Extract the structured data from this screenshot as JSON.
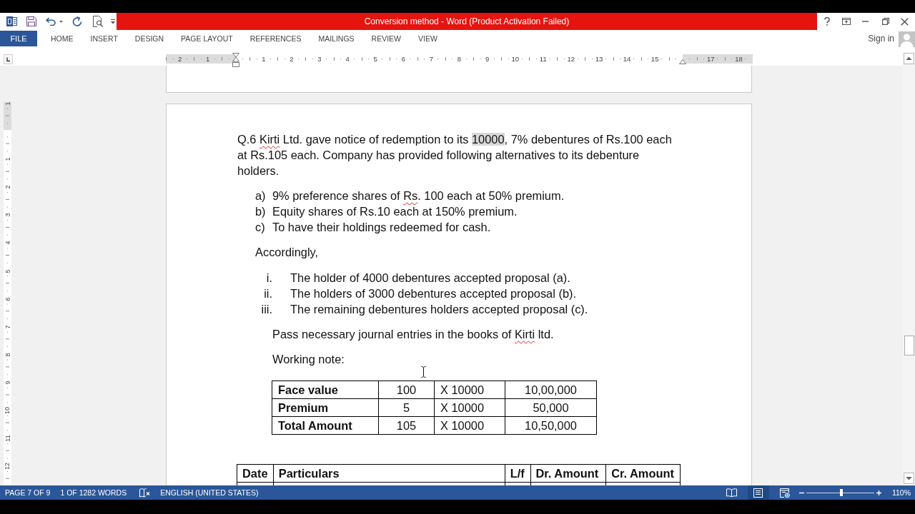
{
  "title_bar": {
    "title": "Conversion method - Word (Product Activation Failed)"
  },
  "ribbon_tabs": [
    {
      "label": "FILE",
      "kind": "file",
      "selected": false
    },
    {
      "label": "HOME",
      "kind": "tab",
      "selected": false
    },
    {
      "label": "INSERT",
      "kind": "tab",
      "selected": false
    },
    {
      "label": "DESIGN",
      "kind": "tab",
      "selected": false
    },
    {
      "label": "PAGE LAYOUT",
      "kind": "tab",
      "selected": false
    },
    {
      "label": "REFERENCES",
      "kind": "tab",
      "selected": false
    },
    {
      "label": "MAILINGS",
      "kind": "tab",
      "selected": false
    },
    {
      "label": "REVIEW",
      "kind": "tab",
      "selected": false
    },
    {
      "label": "VIEW",
      "kind": "tab",
      "selected": false
    }
  ],
  "account": {
    "label": "Sign in"
  },
  "horizontal_ruler": [
    {
      "kind": "label",
      "label": "2"
    },
    {
      "kind": "label",
      "label": "1"
    },
    {
      "kind": "left-indent"
    },
    {
      "kind": "label",
      "label": "1"
    },
    {
      "kind": "label",
      "label": "2"
    },
    {
      "kind": "label",
      "label": "3"
    },
    {
      "kind": "label",
      "label": "4"
    },
    {
      "kind": "label",
      "label": "5"
    },
    {
      "kind": "label",
      "label": "6"
    },
    {
      "kind": "label",
      "label": "7"
    },
    {
      "kind": "label",
      "label": "8"
    },
    {
      "kind": "label",
      "label": "9"
    },
    {
      "kind": "label",
      "label": "10"
    },
    {
      "kind": "label",
      "label": "11"
    },
    {
      "kind": "label",
      "label": "12"
    },
    {
      "kind": "label",
      "label": "13"
    },
    {
      "kind": "label",
      "label": "14"
    },
    {
      "kind": "label",
      "label": "15"
    },
    {
      "kind": "right-indent"
    },
    {
      "kind": "label",
      "label": "17"
    },
    {
      "kind": "label",
      "label": "18"
    }
  ],
  "vertical_ruler": [
    {
      "kind": "label",
      "label": "1"
    },
    {
      "kind": "margin"
    },
    {
      "kind": "label",
      "label": "1"
    },
    {
      "kind": "label",
      "label": "2"
    },
    {
      "kind": "label",
      "label": "3"
    },
    {
      "kind": "label",
      "label": "4"
    },
    {
      "kind": "label",
      "label": "5"
    },
    {
      "kind": "label",
      "label": "6"
    },
    {
      "kind": "label",
      "label": "7"
    },
    {
      "kind": "label",
      "label": "8"
    },
    {
      "kind": "label",
      "label": "9"
    },
    {
      "kind": "label",
      "label": "10"
    },
    {
      "kind": "label",
      "label": "11"
    },
    {
      "kind": "label",
      "label": "12"
    }
  ],
  "document": {
    "question": {
      "runs": [
        {
          "text": "Q.6 ",
          "kind": "plain"
        },
        {
          "text": "Kirti",
          "kind": "misspelled"
        },
        {
          "text": " Ltd. gave notice of redemption to its ",
          "kind": "plain"
        },
        {
          "text": "10000",
          "kind": "highlight"
        },
        {
          "text": ", 7% debentures of Rs.100 each at Rs.105 each. Company has provided following alternatives to its debenture holders.",
          "kind": "plain"
        }
      ]
    },
    "options": [
      {
        "marker": "a)",
        "runs": [
          {
            "text": "9% preference shares of ",
            "kind": "plain"
          },
          {
            "text": "Rs",
            "kind": "misspelled"
          },
          {
            "text": ". 100 each at 50% premium.",
            "kind": "plain"
          }
        ]
      },
      {
        "marker": "b)",
        "runs": [
          {
            "text": "Equity shares of Rs.10 each at 150% premium.",
            "kind": "plain"
          }
        ]
      },
      {
        "marker": "c)",
        "runs": [
          {
            "text": "To have their holdings redeemed for cash.",
            "kind": "plain"
          }
        ]
      }
    ],
    "lead_in": "Accordingly,",
    "cases": [
      {
        "marker": "i.",
        "text": "The holder of 4000 debentures accepted proposal (a)."
      },
      {
        "marker": "ii.",
        "text": "The holders of 3000 debentures accepted proposal (b)."
      },
      {
        "marker": "iii.",
        "text": "The remaining debentures holders accepted proposal (c)."
      }
    ],
    "instruction": {
      "runs": [
        {
          "text": "Pass necessary journal entries in the books of ",
          "kind": "plain"
        },
        {
          "text": "Kirti",
          "kind": "misspelled"
        },
        {
          "text": " ltd.",
          "kind": "plain"
        }
      ]
    },
    "note_heading": "Working note:",
    "working_note_table": {
      "rows": [
        {
          "cells": [
            "Face value",
            "100",
            "X 10000",
            "10,00,000"
          ]
        },
        {
          "cells": [
            "Premium",
            "5",
            "X 10000",
            "50,000"
          ]
        },
        {
          "cells": [
            "Total Amount",
            "105",
            "X 10000",
            "10,50,000"
          ]
        }
      ]
    },
    "journal_table": {
      "columns": [
        "Date",
        "Particulars",
        "L/f",
        "Dr. Amount",
        "Cr. Amount"
      ]
    }
  },
  "status_bar": {
    "page_count": "PAGE 7 OF 9",
    "word_count": "1 OF 1282 WORDS",
    "language": "ENGLISH (UNITED STATES)",
    "views": [
      {
        "kind": "read-mode",
        "selected": false
      },
      {
        "kind": "print-layout",
        "selected": true
      },
      {
        "kind": "web-layout",
        "selected": false
      }
    ],
    "zoom": {
      "level": 0.52,
      "reading": "110%"
    }
  }
}
